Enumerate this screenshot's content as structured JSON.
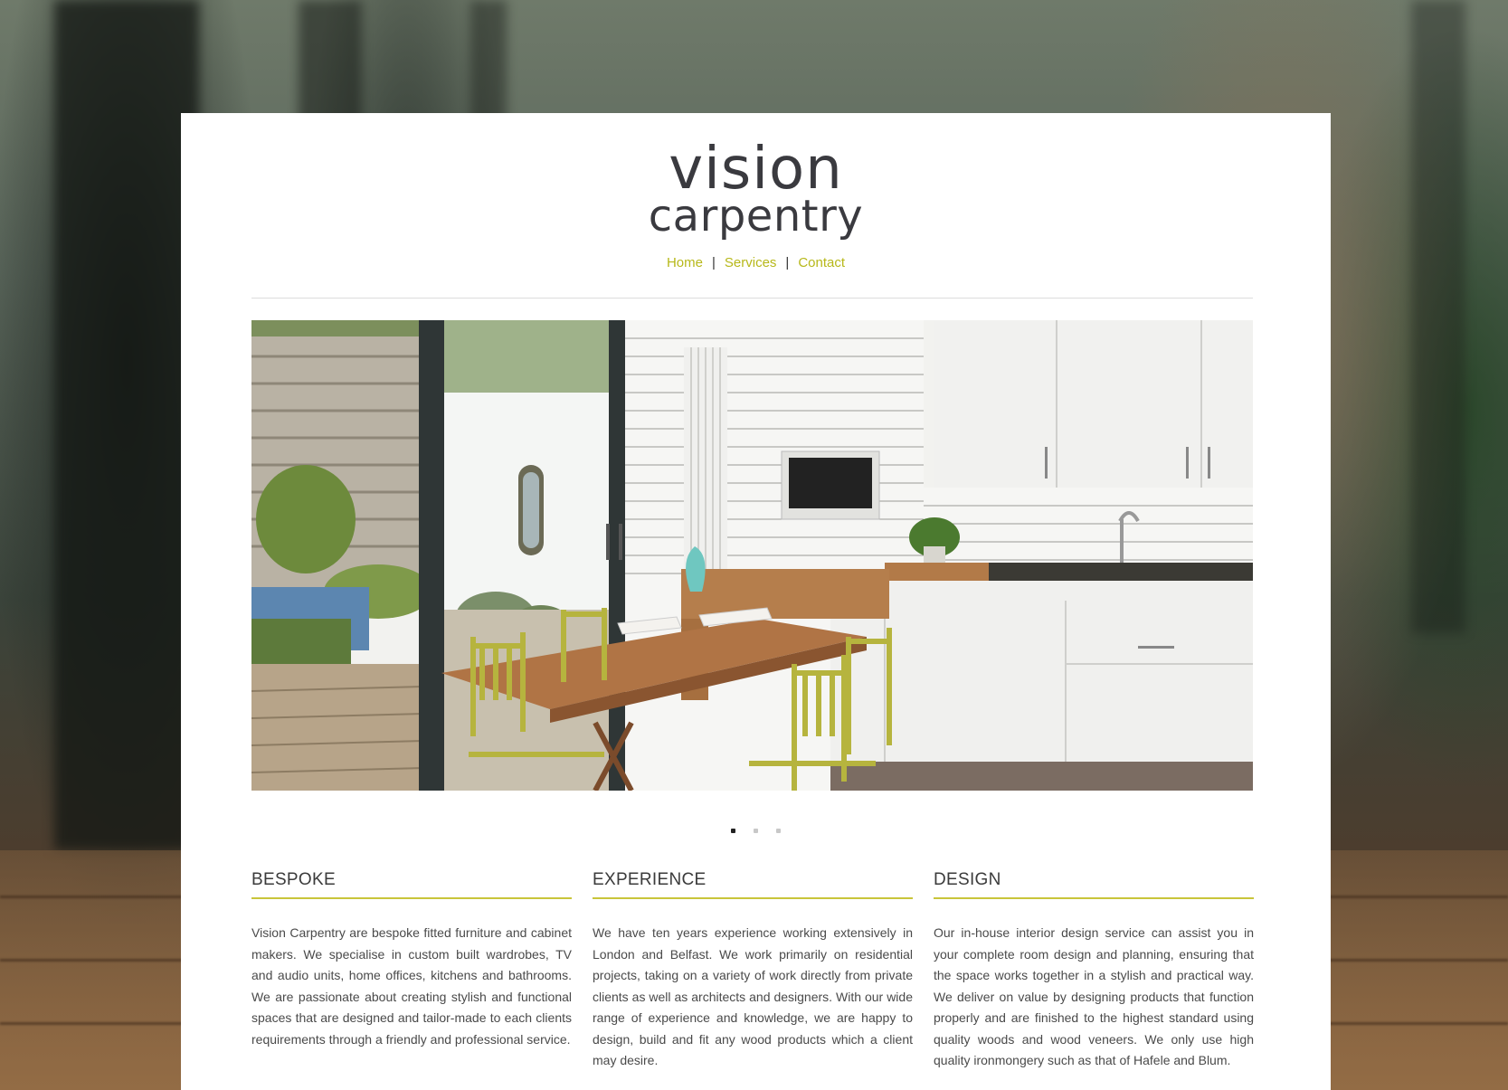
{
  "brand": {
    "line1": "vision",
    "line2": "carpentry"
  },
  "nav": {
    "items": [
      {
        "label": "Home"
      },
      {
        "label": "Services"
      },
      {
        "label": "Contact"
      }
    ],
    "separator": "|"
  },
  "colors": {
    "accent": "#b7b81a",
    "underline": "#c9c53a",
    "text": "#4a4a4a"
  },
  "slider": {
    "total_slides": 3,
    "active_slide": 1
  },
  "sections": [
    {
      "heading": "BESPOKE",
      "body": "Vision Carpentry are bespoke fitted furniture and cabinet makers. We specialise in custom built wardrobes, TV and audio units, home offices, kitchens and bathrooms. We are passionate about creating stylish and functional spaces that are designed and tailor-made to each clients requirements through a friendly and professional service."
    },
    {
      "heading": "EXPERIENCE",
      "body": "We have ten years experience working extensively in London and Belfast. We work primarily on residential projects, taking on a variety of work directly from private clients as well as architects and designers. With our wide range of experience and knowledge, we are happy to design, build and fit any wood products which a client may desire."
    },
    {
      "heading": "DESIGN",
      "body": "Our in-house interior design service can assist you in your complete room design and planning, ensuring that the space works together in a stylish and practical way. We deliver on value by designing products that function properly and are finished to the highest standard using quality woods and wood veneers. We only use high quality ironmongery such as that of Hafele and Blum."
    }
  ]
}
